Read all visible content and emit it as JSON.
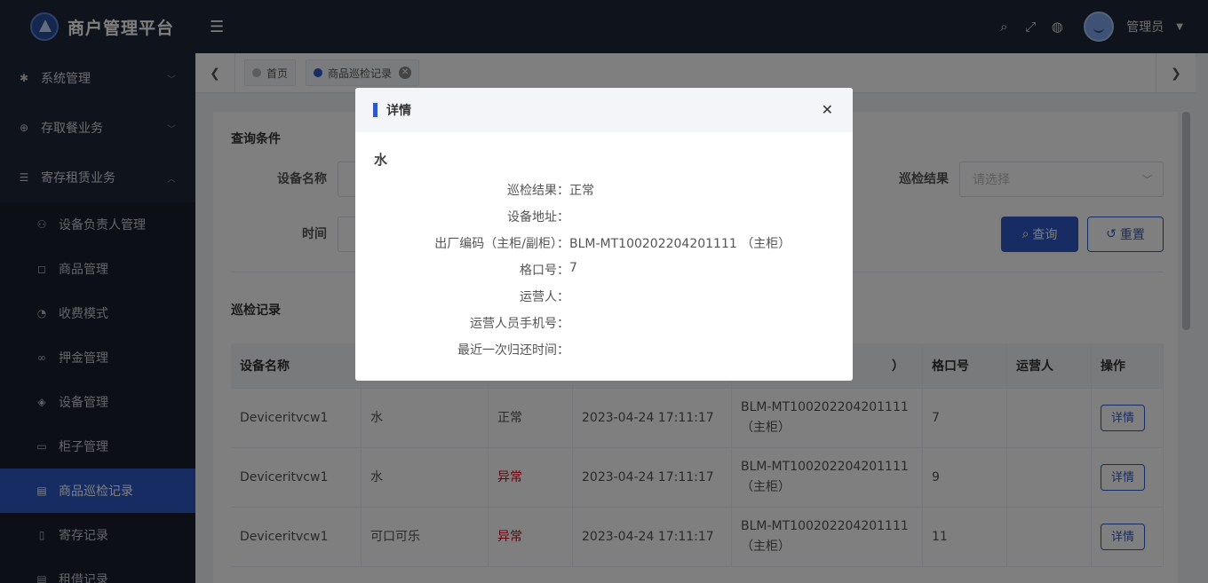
{
  "brand": {
    "title": "商户管理平台"
  },
  "header": {
    "user_name": "管理员"
  },
  "sidebar": {
    "groups": [
      {
        "label": "系统管理"
      },
      {
        "label": "存取餐业务"
      },
      {
        "label": "寄存租赁业务"
      }
    ],
    "items": [
      {
        "label": "设备负责人管理"
      },
      {
        "label": "商品管理"
      },
      {
        "label": "收费模式"
      },
      {
        "label": "押金管理"
      },
      {
        "label": "设备管理"
      },
      {
        "label": "柜子管理"
      },
      {
        "label": "商品巡检记录"
      },
      {
        "label": "寄存记录"
      },
      {
        "label": "租借记录"
      }
    ]
  },
  "tabs": [
    {
      "label": "首页"
    },
    {
      "label": "商品巡检记录"
    }
  ],
  "query": {
    "title": "查询条件",
    "device_name_label": "设备名称",
    "time_label": "时间",
    "result_label": "巡检结果",
    "result_placeholder": "请选择",
    "search_button": "查询",
    "reset_button": "重置"
  },
  "records": {
    "title": "巡检记录",
    "columns": [
      "设备名称",
      "",
      "",
      "",
      "）",
      "格口号",
      "运营人",
      "操作"
    ],
    "rows": [
      {
        "device": "Deviceritvcw1",
        "product": "水",
        "result": "正常",
        "time": "2023-04-24 17:11:17",
        "code": "BLM-MT100202204201111",
        "code_type": "（主柜）",
        "slot": "7",
        "operator": "",
        "action": "详情"
      },
      {
        "device": "Deviceritvcw1",
        "product": "水",
        "result": "异常",
        "time": "2023-04-24 17:11:17",
        "code": "BLM-MT100202204201111",
        "code_type": "（主柜）",
        "slot": "9",
        "operator": "",
        "action": "详情"
      },
      {
        "device": "Deviceritvcw1",
        "product": "可口可乐",
        "result": "异常",
        "time": "2023-04-24 17:11:17",
        "code": "BLM-MT100202204201111",
        "code_type": "（主柜）",
        "slot": "11",
        "operator": "",
        "action": "详情"
      }
    ]
  },
  "modal": {
    "title": "详情",
    "subtitle": "水",
    "fields": [
      {
        "label": "巡检结果：",
        "value": "正常"
      },
      {
        "label": "设备地址：",
        "value": ""
      },
      {
        "label": "出厂编码（主柜/副柜）：",
        "value": "BLM-MT100202204201111 （主柜）"
      },
      {
        "label": "格口号：",
        "value": "7"
      },
      {
        "label": "运营人：",
        "value": ""
      },
      {
        "label": "运营人员手机号：",
        "value": ""
      },
      {
        "label": "最近一次归还时间：",
        "value": ""
      }
    ]
  },
  "colors": {
    "primary": "#2f59c7",
    "sidebar_bg": "#1f2637",
    "warn": "#d9001b"
  }
}
